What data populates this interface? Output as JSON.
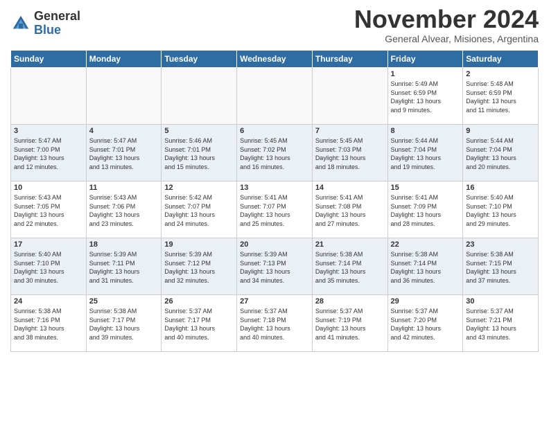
{
  "logo": {
    "general": "General",
    "blue": "Blue"
  },
  "header": {
    "month": "November 2024",
    "location": "General Alvear, Misiones, Argentina"
  },
  "days_of_week": [
    "Sunday",
    "Monday",
    "Tuesday",
    "Wednesday",
    "Thursday",
    "Friday",
    "Saturday"
  ],
  "weeks": [
    [
      {
        "day": "",
        "info": ""
      },
      {
        "day": "",
        "info": ""
      },
      {
        "day": "",
        "info": ""
      },
      {
        "day": "",
        "info": ""
      },
      {
        "day": "",
        "info": ""
      },
      {
        "day": "1",
        "info": "Sunrise: 5:49 AM\nSunset: 6:59 PM\nDaylight: 13 hours\nand 9 minutes."
      },
      {
        "day": "2",
        "info": "Sunrise: 5:48 AM\nSunset: 6:59 PM\nDaylight: 13 hours\nand 11 minutes."
      }
    ],
    [
      {
        "day": "3",
        "info": "Sunrise: 5:47 AM\nSunset: 7:00 PM\nDaylight: 13 hours\nand 12 minutes."
      },
      {
        "day": "4",
        "info": "Sunrise: 5:47 AM\nSunset: 7:01 PM\nDaylight: 13 hours\nand 13 minutes."
      },
      {
        "day": "5",
        "info": "Sunrise: 5:46 AM\nSunset: 7:01 PM\nDaylight: 13 hours\nand 15 minutes."
      },
      {
        "day": "6",
        "info": "Sunrise: 5:45 AM\nSunset: 7:02 PM\nDaylight: 13 hours\nand 16 minutes."
      },
      {
        "day": "7",
        "info": "Sunrise: 5:45 AM\nSunset: 7:03 PM\nDaylight: 13 hours\nand 18 minutes."
      },
      {
        "day": "8",
        "info": "Sunrise: 5:44 AM\nSunset: 7:04 PM\nDaylight: 13 hours\nand 19 minutes."
      },
      {
        "day": "9",
        "info": "Sunrise: 5:44 AM\nSunset: 7:04 PM\nDaylight: 13 hours\nand 20 minutes."
      }
    ],
    [
      {
        "day": "10",
        "info": "Sunrise: 5:43 AM\nSunset: 7:05 PM\nDaylight: 13 hours\nand 22 minutes."
      },
      {
        "day": "11",
        "info": "Sunrise: 5:43 AM\nSunset: 7:06 PM\nDaylight: 13 hours\nand 23 minutes."
      },
      {
        "day": "12",
        "info": "Sunrise: 5:42 AM\nSunset: 7:07 PM\nDaylight: 13 hours\nand 24 minutes."
      },
      {
        "day": "13",
        "info": "Sunrise: 5:41 AM\nSunset: 7:07 PM\nDaylight: 13 hours\nand 25 minutes."
      },
      {
        "day": "14",
        "info": "Sunrise: 5:41 AM\nSunset: 7:08 PM\nDaylight: 13 hours\nand 27 minutes."
      },
      {
        "day": "15",
        "info": "Sunrise: 5:41 AM\nSunset: 7:09 PM\nDaylight: 13 hours\nand 28 minutes."
      },
      {
        "day": "16",
        "info": "Sunrise: 5:40 AM\nSunset: 7:10 PM\nDaylight: 13 hours\nand 29 minutes."
      }
    ],
    [
      {
        "day": "17",
        "info": "Sunrise: 5:40 AM\nSunset: 7:10 PM\nDaylight: 13 hours\nand 30 minutes."
      },
      {
        "day": "18",
        "info": "Sunrise: 5:39 AM\nSunset: 7:11 PM\nDaylight: 13 hours\nand 31 minutes."
      },
      {
        "day": "19",
        "info": "Sunrise: 5:39 AM\nSunset: 7:12 PM\nDaylight: 13 hours\nand 32 minutes."
      },
      {
        "day": "20",
        "info": "Sunrise: 5:39 AM\nSunset: 7:13 PM\nDaylight: 13 hours\nand 34 minutes."
      },
      {
        "day": "21",
        "info": "Sunrise: 5:38 AM\nSunset: 7:14 PM\nDaylight: 13 hours\nand 35 minutes."
      },
      {
        "day": "22",
        "info": "Sunrise: 5:38 AM\nSunset: 7:14 PM\nDaylight: 13 hours\nand 36 minutes."
      },
      {
        "day": "23",
        "info": "Sunrise: 5:38 AM\nSunset: 7:15 PM\nDaylight: 13 hours\nand 37 minutes."
      }
    ],
    [
      {
        "day": "24",
        "info": "Sunrise: 5:38 AM\nSunset: 7:16 PM\nDaylight: 13 hours\nand 38 minutes."
      },
      {
        "day": "25",
        "info": "Sunrise: 5:38 AM\nSunset: 7:17 PM\nDaylight: 13 hours\nand 39 minutes."
      },
      {
        "day": "26",
        "info": "Sunrise: 5:37 AM\nSunset: 7:17 PM\nDaylight: 13 hours\nand 40 minutes."
      },
      {
        "day": "27",
        "info": "Sunrise: 5:37 AM\nSunset: 7:18 PM\nDaylight: 13 hours\nand 40 minutes."
      },
      {
        "day": "28",
        "info": "Sunrise: 5:37 AM\nSunset: 7:19 PM\nDaylight: 13 hours\nand 41 minutes."
      },
      {
        "day": "29",
        "info": "Sunrise: 5:37 AM\nSunset: 7:20 PM\nDaylight: 13 hours\nand 42 minutes."
      },
      {
        "day": "30",
        "info": "Sunrise: 5:37 AM\nSunset: 7:21 PM\nDaylight: 13 hours\nand 43 minutes."
      }
    ]
  ]
}
